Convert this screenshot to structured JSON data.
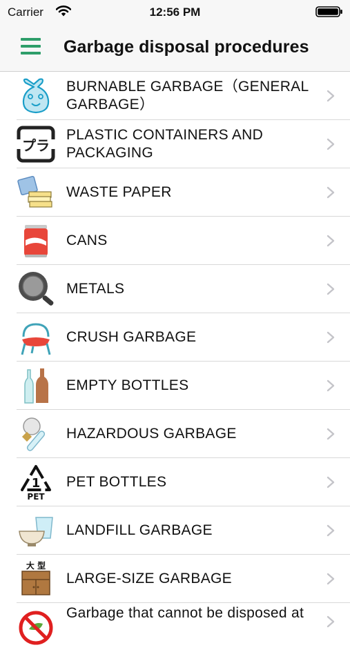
{
  "status_bar": {
    "carrier": "Carrier",
    "time": "12:56 PM"
  },
  "nav": {
    "title": "Garbage disposal procedures",
    "menu_icon": "hamburger-menu-icon"
  },
  "accent_color": "#2e9e6a",
  "items": [
    {
      "label": "BURNABLE GARBAGE（GENERAL GARBAGE）",
      "icon": "garbage-bag-icon"
    },
    {
      "label": "PLASTIC CONTAINERS AND PACKAGING",
      "icon": "plastic-mark-icon",
      "icon_text": "プラ"
    },
    {
      "label": "WASTE PAPER",
      "icon": "paper-bundle-icon"
    },
    {
      "label": "CANS",
      "icon": "can-icon"
    },
    {
      "label": "METALS",
      "icon": "frying-pan-icon"
    },
    {
      "label": "CRUSH GARBAGE",
      "icon": "chair-icon"
    },
    {
      "label": "EMPTY BOTTLES",
      "icon": "bottles-icon"
    },
    {
      "label": "HAZARDOUS GARBAGE",
      "icon": "bulb-thermometer-icon"
    },
    {
      "label": "PET BOTTLES",
      "icon": "pet-recycle-icon",
      "icon_text": "1",
      "icon_caption": "PET"
    },
    {
      "label": "LANDFILL GARBAGE",
      "icon": "bowl-cup-icon"
    },
    {
      "label": "LARGE-SIZE GARBAGE",
      "icon": "cabinet-icon",
      "icon_text": "大 型"
    },
    {
      "label": "Garbage that cannot be disposed at",
      "icon": "prohibited-icon"
    }
  ]
}
